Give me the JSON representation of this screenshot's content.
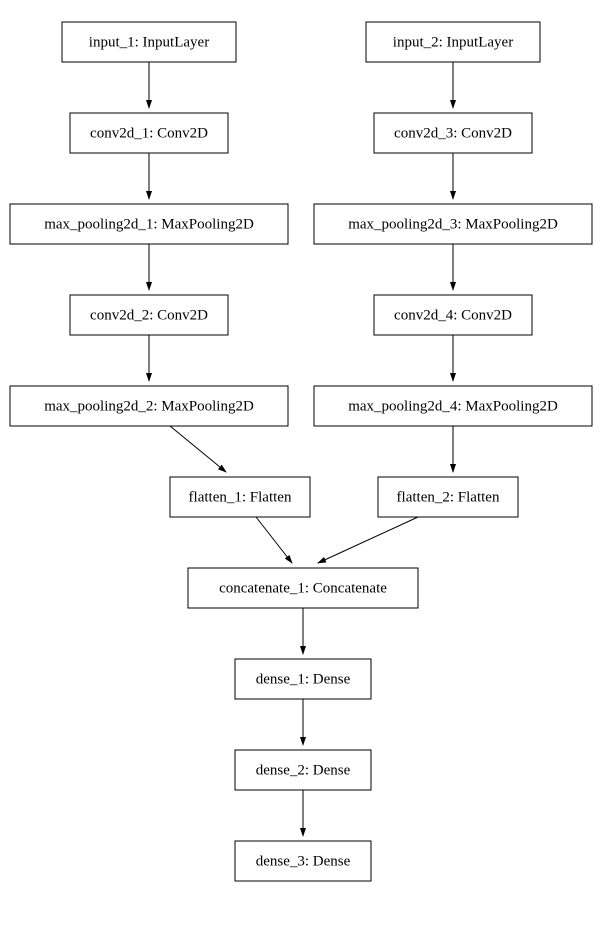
{
  "nodes": {
    "input_1": "input_1: InputLayer",
    "conv2d_1": "conv2d_1: Conv2D",
    "max_pooling2d_1": "max_pooling2d_1: MaxPooling2D",
    "conv2d_2": "conv2d_2: Conv2D",
    "max_pooling2d_2": "max_pooling2d_2: MaxPooling2D",
    "flatten_1": "flatten_1: Flatten",
    "input_2": "input_2: InputLayer",
    "conv2d_3": "conv2d_3: Conv2D",
    "max_pooling2d_3": "max_pooling2d_3: MaxPooling2D",
    "conv2d_4": "conv2d_4: Conv2D",
    "max_pooling2d_4": "max_pooling2d_4: MaxPooling2D",
    "flatten_2": "flatten_2: Flatten",
    "concatenate_1": "concatenate_1: Concatenate",
    "dense_1": "dense_1: Dense",
    "dense_2": "dense_2: Dense",
    "dense_3": "dense_3: Dense"
  }
}
